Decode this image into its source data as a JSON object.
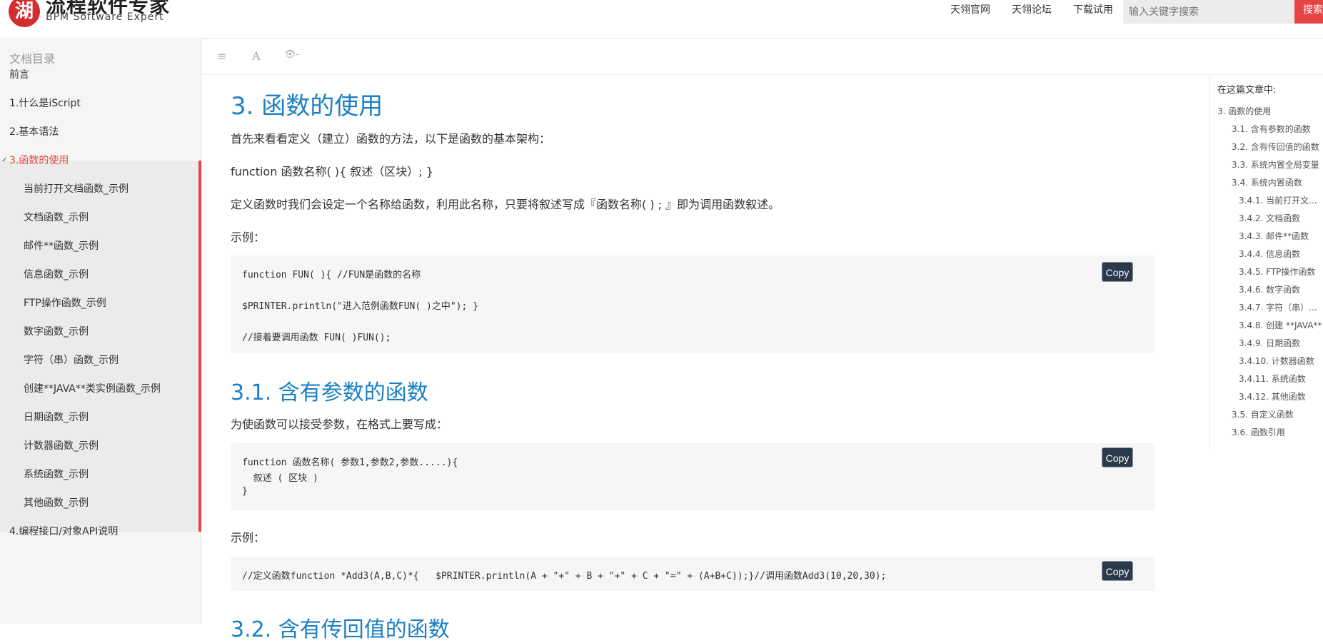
{
  "header": {
    "logo_mark": "湖",
    "logo_title": "流程软件专家",
    "logo_sub": "BPM Software Expert",
    "nav": [
      "天翎官网",
      "天翎论坛",
      "下载试用"
    ],
    "search_placeholder": "输入关键字搜索",
    "search_button": "搜索"
  },
  "sidebar": {
    "title": "文档目录",
    "items": [
      "前言",
      "1.什么是iScript",
      "2.基本语法",
      "3.函数的使用",
      "当前打开文档函数_示例",
      "文档函数_示例",
      "邮件**函数_示例",
      "信息函数_示例",
      "FTP操作函数_示例",
      "数字函数_示例",
      "字符（串）函数_示例",
      "创建**JAVA**类实例函数_示例",
      "日期函数_示例",
      "计数器函数_示例",
      "系统函数_示例",
      "其他函数_示例",
      "4.编程接口/对象API说明"
    ],
    "active": "3.函数的使用"
  },
  "toolbar": {
    "icons": [
      "list-icon",
      "font-icon",
      "eye-icon"
    ]
  },
  "content": {
    "h1": "3. 函数的使用",
    "p1": "首先来看看定义（建立）函数的方法，以下是函数的基本架构：",
    "p2": "function 函数名称( ){ 叙述（区块）; }",
    "p3": "定义函数时我们会设定一个名称给函数，利用此名称，只要将叙述写成『函数名称( ) ; 』即为调用函数叙述。",
    "p4": "示例：",
    "code1": [
      "function FUN( ){ //FUN是函数的名称",
      "$PRINTER.println(\"进入范例函数FUN( )之中\"); }",
      "//接着要调用函数 FUN( )FUN();"
    ],
    "h2a": "3.1. 含有参数的函数",
    "p5": "为使函数可以接受参数，在格式上要写成：",
    "code2": [
      "function 函数名称( 参数1,参数2,参数.....){",
      "  叙述 ( 区块 )",
      "}"
    ],
    "p6": "示例：",
    "code3": [
      "//定义函数function *Add3(A,B,C)*{   $PRINTER.println(A + \"+\" + B + \"+\" + C + \"=\" + (A+B+C));}//调用函数Add3(10,20,30);"
    ],
    "h2b": "3.2. 含有传回值的函数",
    "copy_label": "Copy"
  },
  "rtoc": {
    "title": "在这篇文章中:",
    "items": [
      "3. 函数的使用",
      "3.1. 含有参数的函数",
      "3.2. 含有传回值的函数",
      "3.3. 系统内置全局变量",
      "3.4. 系统内置函数",
      "3.4.1. 当前打开文...",
      "3.4.2. 文档函数",
      "3.4.3. 邮件**函数",
      "3.4.4. 信息函数",
      "3.4.5. FTP操作函数",
      "3.4.6. 数字函数",
      "3.4.7. 字符（串）...",
      "3.4.8. 创建 **JAVA**",
      "3.4.9. 日期函数",
      "3.4.10. 计数器函数",
      "3.4.11. 系统函数",
      "3.4.12. 其他函数",
      "3.5. 自定义函数",
      "3.6. 函数引用"
    ]
  },
  "colors": {
    "accent_red": "#e64545",
    "heading_blue": "#1c80c4",
    "copy_bg": "#2b3a4a"
  }
}
